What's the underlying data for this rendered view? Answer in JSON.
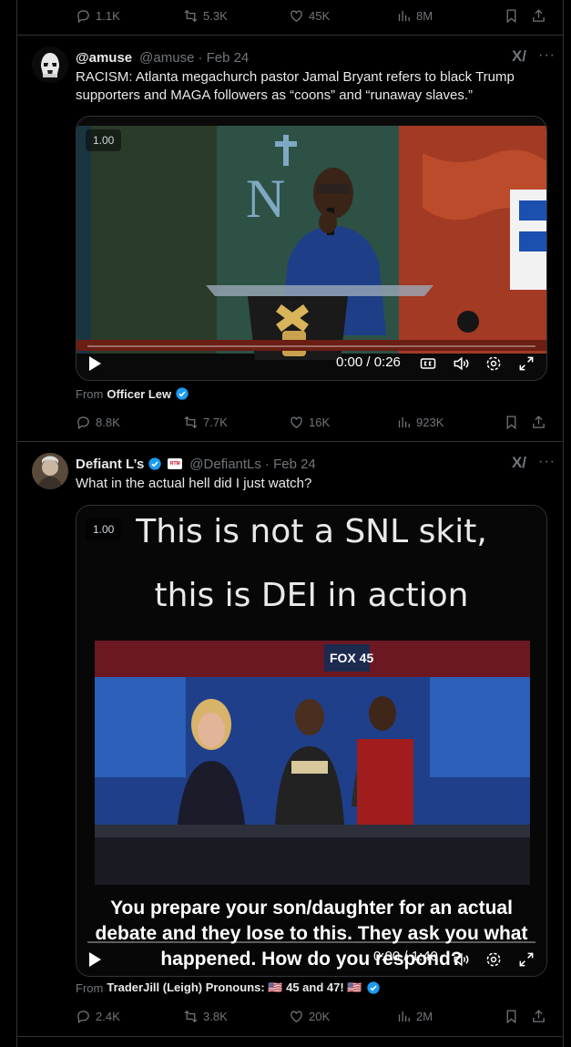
{
  "top_actions": {
    "replies": "1.1K",
    "reposts": "5.3K",
    "likes": "45K",
    "views": "8M"
  },
  "tweets": [
    {
      "name": "@amuse",
      "handle": "@amuse",
      "date": "· Feb 24",
      "text": "RACISM: Atlanta megachurch pastor Jamal Bryant refers to black Trump supporters and MAGA followers as “coons” and “runaway slaves.”",
      "video": {
        "speed": "1.00",
        "time": "0:00 / 0:26"
      },
      "from_label": "From",
      "from_name": "Officer Lew",
      "actions": {
        "replies": "8.8K",
        "reposts": "7.7K",
        "likes": "16K",
        "views": "923K"
      }
    },
    {
      "name": "Defiant L’s",
      "badge": "RTM",
      "handle": "@DefiantLs",
      "date": "· Feb 24",
      "text": "What in the actual hell did I just watch?",
      "video": {
        "speed": "1.00",
        "time": "0:00 / 1:40",
        "caption_top_1": "This is not a SNL skit,",
        "caption_top_2": "this is DEI in action",
        "caption_bottom": "You prepare your son/daughter for an actual debate and they lose to this. They ask you what happened. How do you respond?",
        "scene_logo": "FOX 45"
      },
      "from_label": "From",
      "from_name": "TraderJill (Leigh) Pronouns: 🇺🇸 45 and 47! 🇺🇸",
      "actions": {
        "replies": "2.4K",
        "reposts": "3.8K",
        "likes": "20K",
        "views": "2M"
      }
    }
  ],
  "colors": {
    "background": "#000000",
    "text": "#e7e9ea",
    "muted": "#71767b",
    "verified": "#1d9bf0",
    "border": "#2f3336"
  },
  "icons": [
    "reply-icon",
    "repost-icon",
    "like-icon",
    "views-icon",
    "bookmark-icon",
    "share-icon",
    "grok-icon",
    "more-icon",
    "verified-icon",
    "play-icon",
    "captions-icon",
    "volume-icon",
    "settings-icon",
    "fullscreen-icon"
  ]
}
